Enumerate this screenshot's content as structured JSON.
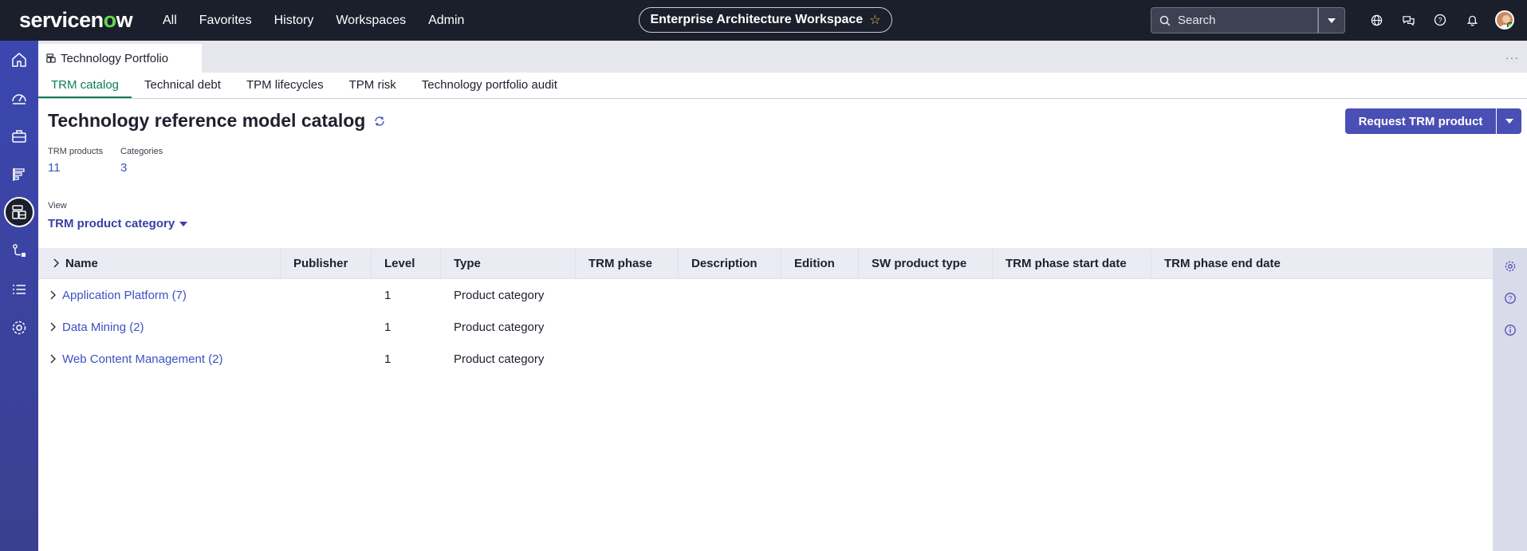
{
  "brand": {
    "logo_text_a": "servicen",
    "logo_text_o": "o",
    "logo_text_b": "w"
  },
  "nav": {
    "items": [
      "All",
      "Favorites",
      "History",
      "Workspaces",
      "Admin"
    ]
  },
  "workspace": {
    "title": "Enterprise Architecture Workspace"
  },
  "search": {
    "placeholder": "Search"
  },
  "top_icons": [
    "globe-icon",
    "chat-icon",
    "help-icon",
    "bell-icon"
  ],
  "rail": {
    "icons": [
      "home-icon",
      "dashboard-icon",
      "briefcase-icon",
      "roadmap-icon",
      "technology-portfolio-icon",
      "flow-icon",
      "list-icon",
      "settings-icon"
    ],
    "active_index": 4
  },
  "tabstrip": {
    "page_tab": "Technology Portfolio"
  },
  "subtabs": {
    "items": [
      "TRM catalog",
      "Technical debt",
      "TPM lifecycles",
      "TPM risk",
      "Technology portfolio audit"
    ],
    "active": "TRM catalog"
  },
  "page": {
    "title": "Technology reference model catalog",
    "request_button": "Request TRM product",
    "stats": [
      {
        "label": "TRM products",
        "value": "11"
      },
      {
        "label": "Categories",
        "value": "3"
      }
    ],
    "view_label": "View",
    "view_value": "TRM product category"
  },
  "table": {
    "columns": [
      "Name",
      "Publisher",
      "Level",
      "Type",
      "TRM phase",
      "Description",
      "Edition",
      "SW product type",
      "TRM phase start date",
      "TRM phase end date"
    ],
    "rows": [
      {
        "name": "Application Platform (7)",
        "publisher": "",
        "level": "1",
        "type": "Product category"
      },
      {
        "name": "Data Mining (2)",
        "publisher": "",
        "level": "1",
        "type": "Product category"
      },
      {
        "name": "Web Content Management (2)",
        "publisher": "",
        "level": "1",
        "type": "Product category"
      }
    ]
  },
  "right_rail": {
    "icons": [
      "settings-icon",
      "help-icon",
      "info-icon"
    ]
  },
  "colors": {
    "topbar": "#1b1f2c",
    "accent": "#4a4fb5",
    "link": "#3a52c4",
    "active_tab": "#0d7d5a",
    "rail": "#3b47b0"
  }
}
